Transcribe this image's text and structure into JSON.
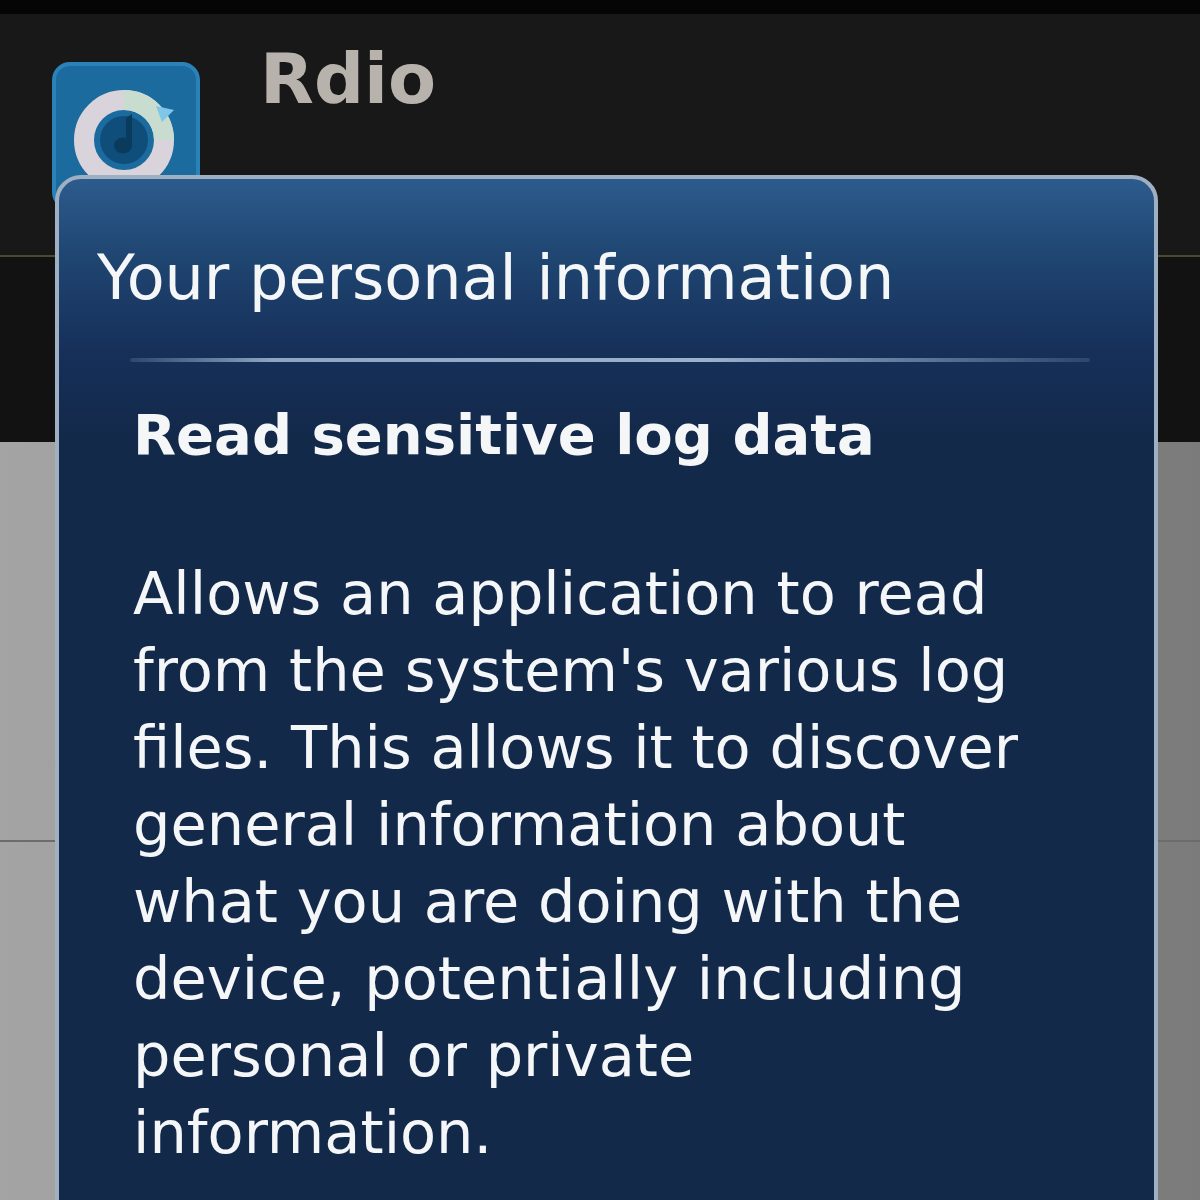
{
  "app": {
    "title": "Rdio"
  },
  "dialog": {
    "title": "Your personal information",
    "permission": {
      "name": "Read sensitive log data",
      "description": "Allows an application to read from the system's various log files. This allows it to discover general information about what you are doing with the device, potentially including personal or private information."
    }
  }
}
